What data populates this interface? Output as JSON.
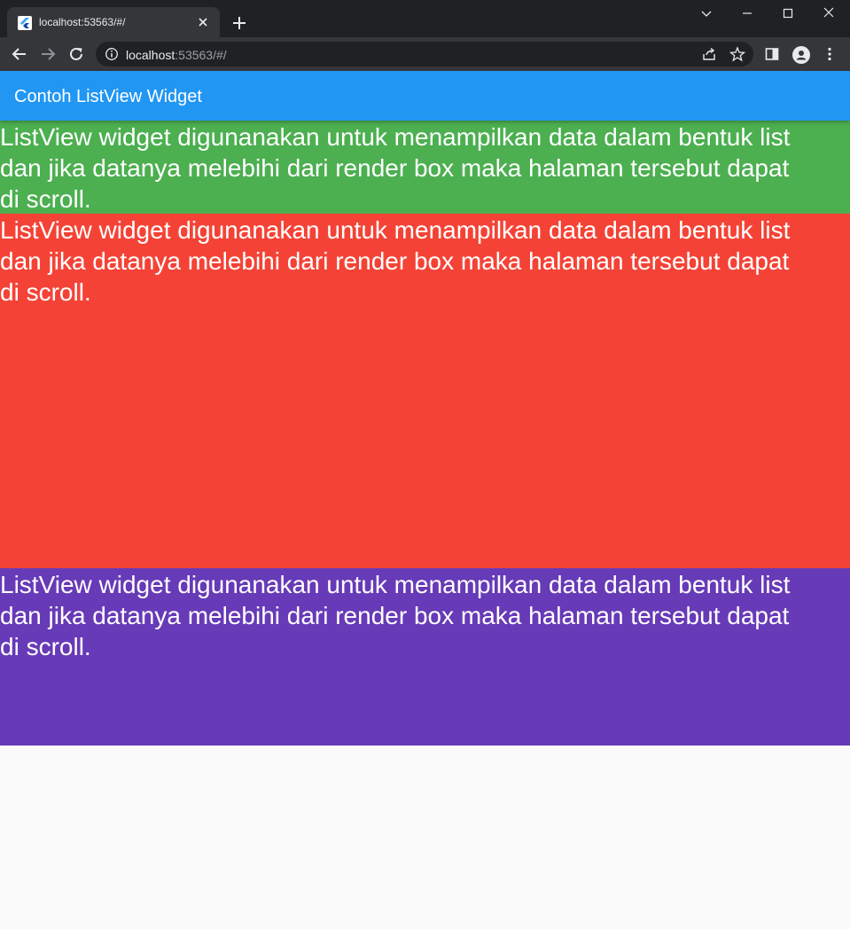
{
  "browser": {
    "tab_title": "localhost:53563/#/",
    "url_host": "localhost",
    "url_rest": ":53563/#/"
  },
  "app": {
    "title": "Contoh ListView Widget",
    "colors": {
      "appbar": "#2196f3",
      "item1": "#4caf50",
      "item2": "#f44336",
      "item3": "#673ab7",
      "background": "#fafafa"
    }
  },
  "list": {
    "items": [
      {
        "text": "ListView widget digunanakan untuk menampilkan data dalam bentuk list dan jika datanya melebihi dari render box maka halaman tersebut dapat di scroll."
      },
      {
        "text": "ListView widget digunanakan untuk menampilkan data dalam bentuk list dan jika datanya melebihi dari render box maka halaman tersebut dapat di scroll."
      },
      {
        "text": "ListView widget digunanakan untuk menampilkan data dalam bentuk list dan jika datanya melebihi dari render box maka halaman tersebut dapat di scroll."
      }
    ]
  }
}
